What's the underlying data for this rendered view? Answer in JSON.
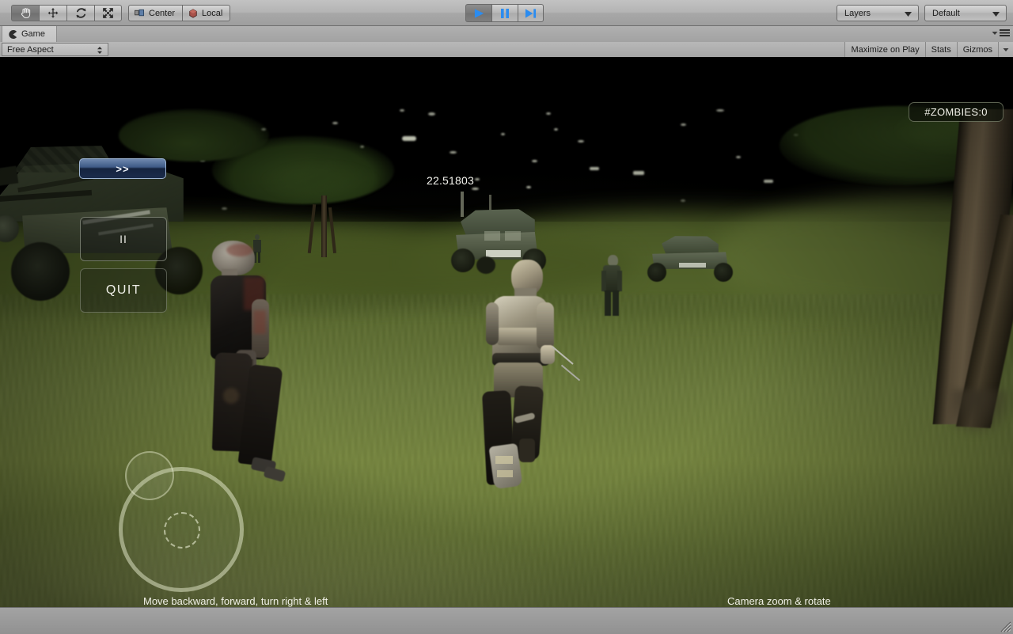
{
  "toolbar": {
    "tools": [
      {
        "name": "hand-tool",
        "icon": "hand-icon",
        "active": true
      },
      {
        "name": "move-tool",
        "icon": "move-icon",
        "active": false
      },
      {
        "name": "rotate-tool",
        "icon": "rotate-icon",
        "active": false
      },
      {
        "name": "scale-tool",
        "icon": "scale-icon",
        "active": false
      }
    ],
    "pivot_mode_label": "Center",
    "pivot_rotation_label": "Local",
    "play_label": "play-icon",
    "pause_label": "pause-icon",
    "step_label": "step-icon",
    "layers_label": "Layers",
    "layout_label": "Default"
  },
  "panel": {
    "tab_label": "Game",
    "tab_icon": "game-view-icon",
    "menu_icon": "panel-menu-icon",
    "aspect_label": "Free Aspect",
    "maximize_on_play_label": "Maximize on Play",
    "stats_label": "Stats",
    "gizmos_label": "Gizmos"
  },
  "game_hud": {
    "zombies_counter": "#ZOMBIES:0",
    "timer": "22.51803",
    "next_button_label": ">>",
    "pause_button_label": "II",
    "quit_button_label": "QUIT",
    "move_caption": "Move backward, forward, turn right & left",
    "camera_caption": "Camera zoom & rotate"
  },
  "colors": {
    "toolbar_bg": "#b4b4b4",
    "panel_bg": "#9b9b9b",
    "play_blue": "#2b8cf0",
    "hud_text": "#f2f2ea",
    "next_btn_blue": "#3e5a86",
    "grass": "#6c7c3c",
    "sky": "#000000"
  }
}
